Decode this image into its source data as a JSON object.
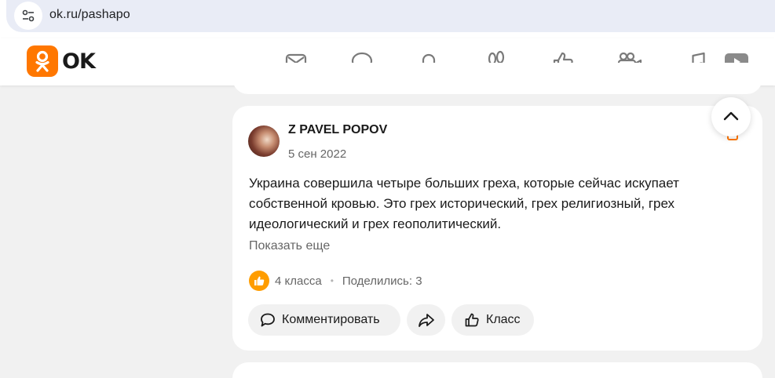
{
  "browser": {
    "url": "ok.ru/pashapo"
  },
  "header": {
    "logo_text": "OK",
    "brand_color": "#ff7700",
    "nav_icons": [
      "mail-icon",
      "chat-icon",
      "bell-icon",
      "footprints-icon",
      "like-icon",
      "video-camera-icon",
      "music-icon",
      "video-play-icon"
    ]
  },
  "post": {
    "author": "Z PAVEL POPOV",
    "date": "5 сен 2022",
    "text": "Украина совершила четыре больших греха, которые сейчас искупает собственной кровью. Это грех исторический, грех религиозный, грех идеологический и грех геополитический.",
    "show_more": "Показать еще",
    "likes": "4 класса",
    "shares": "Поделились: 3",
    "actions": {
      "comment": "Комментировать",
      "class": "Класс"
    }
  },
  "colors": {
    "accent": "#ff7700",
    "like_badge": "#ff9d00",
    "page_bg": "#f1f1f1",
    "button_bg": "#f1f1f1"
  }
}
